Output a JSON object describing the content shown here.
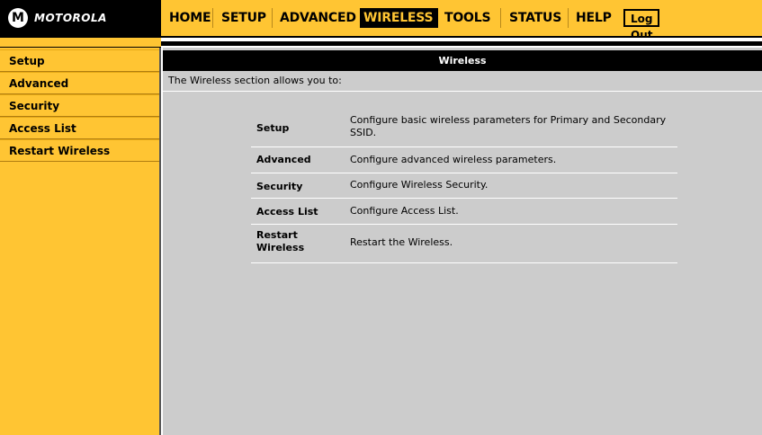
{
  "brand": {
    "logo_mark": "M",
    "name": "MOTOROLA"
  },
  "nav": {
    "items": [
      "HOME",
      "SETUP",
      "ADVANCED",
      "WIRELESS",
      "TOOLS",
      "STATUS",
      "HELP"
    ],
    "active": "WIRELESS",
    "logout_label": "Log Out"
  },
  "sidebar": {
    "items": [
      {
        "label": "Setup"
      },
      {
        "label": "Advanced"
      },
      {
        "label": "Security"
      },
      {
        "label": "Access List"
      },
      {
        "label": "Restart Wireless"
      }
    ]
  },
  "main": {
    "header": "Wireless",
    "intro": "The Wireless section allows you to:",
    "rows": [
      {
        "name": "Setup",
        "desc": "Configure basic wireless parameters for Primary and Secondary SSID."
      },
      {
        "name": "Advanced",
        "desc": "Configure advanced wireless parameters."
      },
      {
        "name": "Security",
        "desc": "Configure Wireless Security."
      },
      {
        "name": "Access List",
        "desc": "Configure Access List."
      },
      {
        "name": "Restart Wireless",
        "desc": "Restart the Wireless."
      }
    ]
  },
  "colors": {
    "accent": "#ffc533",
    "header_bg": "#000000",
    "content_bg": "#cccccc"
  }
}
